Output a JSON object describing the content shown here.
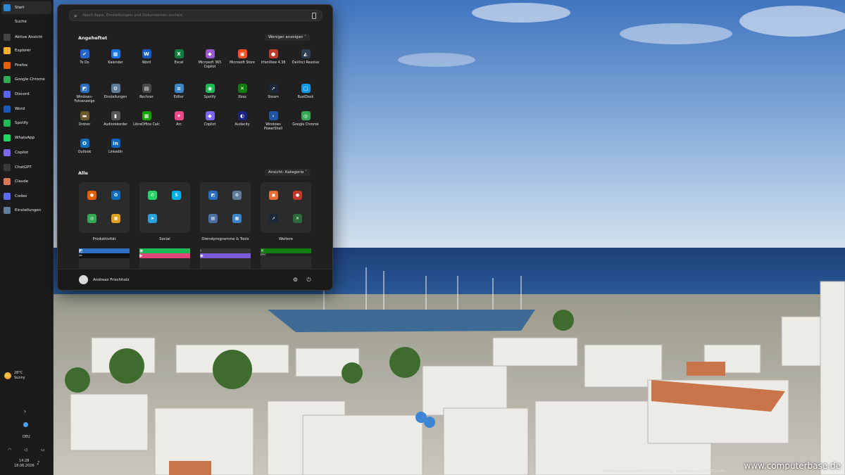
{
  "taskbar": {
    "items": [
      {
        "label": "Start",
        "icon": "windows-icon",
        "color": "#2b88d8"
      },
      {
        "label": "Suche",
        "icon": "none",
        "color": ""
      },
      {
        "label": "Aktive Ansicht",
        "icon": "task-view-icon",
        "color": "#444"
      },
      {
        "label": "Explorer",
        "icon": "folder-icon",
        "color": "#f3b52c"
      },
      {
        "label": "Firefox",
        "icon": "firefox-icon",
        "color": "#e66000"
      },
      {
        "label": "Google Chrome",
        "icon": "chrome-icon",
        "color": "#34a853"
      },
      {
        "label": "Discord",
        "icon": "discord-icon",
        "color": "#5865f2"
      },
      {
        "label": "Word",
        "icon": "word-icon",
        "color": "#185abd"
      },
      {
        "label": "Spotify",
        "icon": "spotify-icon",
        "color": "#1db954"
      },
      {
        "label": "WhatsApp",
        "icon": "whatsapp-icon",
        "color": "#25d366"
      },
      {
        "label": "Copilot",
        "icon": "copilot-icon",
        "color": "#7b68ee"
      },
      {
        "label": "ChatGPT",
        "icon": "chatgpt-icon",
        "color": "#3a3a3a"
      },
      {
        "label": "Claude",
        "icon": "claude-icon",
        "color": "#d97757"
      },
      {
        "label": "Codex",
        "icon": "codex-icon",
        "color": "#5b6cf0"
      },
      {
        "label": "Einstellungen",
        "icon": "settings-icon",
        "color": "#607d9c"
      }
    ],
    "weather": {
      "temp": "28°C",
      "condition": "Sunny"
    },
    "chevron": "›",
    "language": "DEU",
    "time": "14:28",
    "date": "18.06.2026"
  },
  "start_menu": {
    "search_placeholder": "Nach Apps, Einstellungen und Dokumenten suchen",
    "pinned_title": "Angeheftet",
    "pinned_toggle": "Weniger anzeigen",
    "pinned": [
      {
        "label": "To Do",
        "icon": "todo-icon",
        "color": "#2564cf",
        "glyph": "✔"
      },
      {
        "label": "Kalender",
        "icon": "calendar-icon",
        "color": "#1a73e8",
        "glyph": "▦"
      },
      {
        "label": "Word",
        "icon": "word-icon",
        "color": "#185abd",
        "glyph": "W"
      },
      {
        "label": "Excel",
        "icon": "excel-icon",
        "color": "#107c41",
        "glyph": "X"
      },
      {
        "label": "Microsoft 365 Copilot",
        "icon": "m365-copilot-icon",
        "color": "#9b59d0",
        "glyph": "◆"
      },
      {
        "label": "Microsoft Store",
        "icon": "store-icon",
        "color": "#f25022",
        "glyph": "▣"
      },
      {
        "label": "IrfanView 4.38",
        "icon": "irfanview-icon",
        "color": "#c0392b",
        "glyph": "●"
      },
      {
        "label": "DaVinci Resolve",
        "icon": "davinci-icon",
        "color": "#2d3e50",
        "glyph": "◭"
      },
      {
        "label": "Windows-Fotoanzeige",
        "icon": "photo-viewer-icon",
        "color": "#2b6fc2",
        "glyph": "◩"
      },
      {
        "label": "Einstellungen",
        "icon": "settings-icon",
        "color": "#607d9c",
        "glyph": "⚙"
      },
      {
        "label": "Rechner",
        "icon": "calculator-icon",
        "color": "#4a4a4a",
        "glyph": "▤"
      },
      {
        "label": "Editor",
        "icon": "notepad-icon",
        "color": "#3a86c8",
        "glyph": "≡"
      },
      {
        "label": "Spotify",
        "icon": "spotify-icon",
        "color": "#1db954",
        "glyph": "◉"
      },
      {
        "label": "Xbox",
        "icon": "xbox-icon",
        "color": "#107c10",
        "glyph": "✕"
      },
      {
        "label": "Steam",
        "icon": "steam-icon",
        "color": "#1b2838",
        "glyph": "➚"
      },
      {
        "label": "RustDesk",
        "icon": "rustdesk-icon",
        "color": "#1296e6",
        "glyph": "▢"
      },
      {
        "label": "Ordner",
        "icon": "folder-icon",
        "color": "#6b5a2a",
        "glyph": "▬"
      },
      {
        "label": "Audiorekorder",
        "icon": "microphone-icon",
        "color": "#555",
        "glyph": "▮"
      },
      {
        "label": "LibreOffice Calc",
        "icon": "libreoffice-calc-icon",
        "color": "#18a303",
        "glyph": "▦"
      },
      {
        "label": "Arc",
        "icon": "arc-icon",
        "color": "#e84a8a",
        "glyph": "✦"
      },
      {
        "label": "Copilot",
        "icon": "copilot-icon",
        "color": "#7b68ee",
        "glyph": "◆"
      },
      {
        "label": "Audacity",
        "icon": "audacity-icon",
        "color": "#1a237e",
        "glyph": "◐"
      },
      {
        "label": "Windows PowerShell",
        "icon": "powershell-icon",
        "color": "#2455a4",
        "glyph": "›"
      },
      {
        "label": "Google Chrome",
        "icon": "chrome-icon",
        "color": "#34a853",
        "glyph": "◎"
      },
      {
        "label": "Outlook",
        "icon": "outlook-icon",
        "color": "#0f6cbd",
        "glyph": "O"
      },
      {
        "label": "LinkedIn",
        "icon": "linkedin-icon",
        "color": "#0a66c2",
        "glyph": "in"
      }
    ],
    "all_title": "Alle",
    "all_view": "Ansicht: Kategorie",
    "categories": [
      {
        "label": "Produktivität",
        "icons": [
          {
            "icon": "firefox-icon",
            "color": "#e66000",
            "glyph": "●"
          },
          {
            "icon": "outlook-icon",
            "color": "#0f6cbd",
            "glyph": "O"
          },
          {
            "icon": "chrome-icon",
            "color": "#34a853",
            "glyph": "◎"
          },
          {
            "icon": "apps-icon",
            "color": "#e0a020",
            "glyph": "▦"
          }
        ]
      },
      {
        "label": "Social",
        "icons": [
          {
            "icon": "whatsapp-icon",
            "color": "#25d366",
            "glyph": "✆"
          },
          {
            "icon": "skype-icon",
            "color": "#00aff0",
            "glyph": "S"
          },
          {
            "icon": "telegram-icon",
            "color": "#2aa1da",
            "glyph": "➤"
          }
        ]
      },
      {
        "label": "Dienstprogramme & Tools",
        "icons": [
          {
            "icon": "photo-viewer-icon",
            "color": "#2b6fc2",
            "glyph": "◩"
          },
          {
            "icon": "settings-icon",
            "color": "#607d9c",
            "glyph": "⚙"
          },
          {
            "icon": "calculator-icon",
            "color": "#4a6fa5",
            "glyph": "▤"
          },
          {
            "icon": "apps-icon",
            "color": "#3a86c8",
            "glyph": "▦"
          }
        ]
      },
      {
        "label": "Weitere",
        "icons": [
          {
            "icon": "store-icon",
            "color": "#e86a33",
            "glyph": "▣"
          },
          {
            "icon": "irfanview-icon",
            "color": "#c0392b",
            "glyph": "●"
          },
          {
            "icon": "steam-icon",
            "color": "#1b2838",
            "glyph": "➚"
          },
          {
            "icon": "xbox-icon",
            "color": "#2d6b3b",
            "glyph": "✕"
          }
        ]
      }
    ],
    "partial_row": [
      {
        "icons": [
          {
            "icon": "photo-viewer-icon",
            "color": "#2b6fc2",
            "glyph": "◩"
          },
          {
            "icon": "capcut-icon",
            "color": "#111",
            "glyph": "✂"
          }
        ]
      },
      {
        "icons": [
          {
            "icon": "spotify-icon",
            "color": "#1db954",
            "glyph": "◉"
          },
          {
            "icon": "media-player-icon",
            "color": "#e0457b",
            "glyph": "▶"
          }
        ]
      },
      {
        "icons": [
          {
            "icon": "terminal-icon",
            "color": "#333",
            "glyph": "›"
          },
          {
            "icon": "obsidian-icon",
            "color": "#7c5ad9",
            "glyph": "◆"
          }
        ]
      },
      {
        "icons": [
          {
            "icon": "xbox-icon",
            "color": "#107c10",
            "glyph": "✕"
          },
          {
            "icon": "epic-games-icon",
            "color": "#222",
            "glyph": "EPIC"
          }
        ]
      }
    ],
    "user": "Andreas Frischholz"
  },
  "wallpaper": {
    "watermark": "www.computerbase.de",
    "build_text": "Evaluierungskopie. Build 26200.6537.ge_prerelease_im.250820-1450"
  }
}
